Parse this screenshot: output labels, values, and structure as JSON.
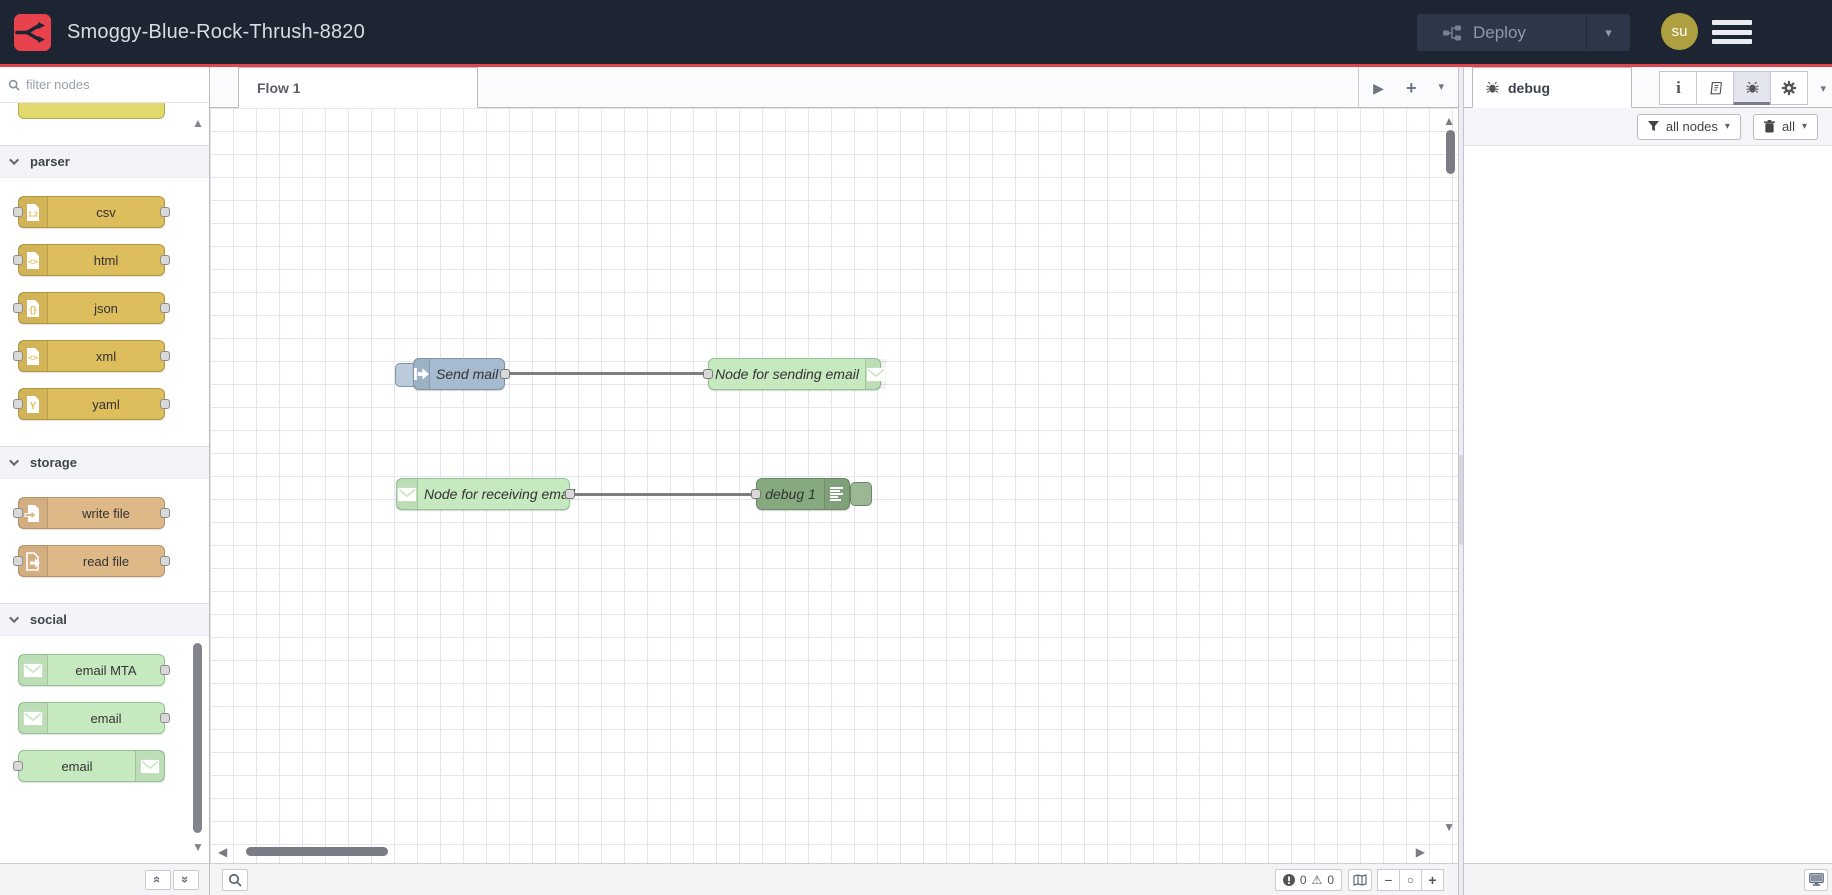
{
  "header": {
    "title": "Smoggy-Blue-Rock-Thrush-8820",
    "deploy_label": "Deploy",
    "user_initials": "su"
  },
  "palette": {
    "search_placeholder": "filter nodes",
    "categories": [
      {
        "label": "parser",
        "nodes": [
          {
            "label": "csv"
          },
          {
            "label": "html"
          },
          {
            "label": "json"
          },
          {
            "label": "xml"
          },
          {
            "label": "yaml"
          }
        ]
      },
      {
        "label": "storage",
        "nodes": [
          {
            "label": "write file"
          },
          {
            "label": "read file"
          }
        ]
      },
      {
        "label": "social",
        "nodes": [
          {
            "label": "email MTA"
          },
          {
            "label": "email"
          },
          {
            "label": "email"
          }
        ]
      }
    ]
  },
  "workspace": {
    "tab_label": "Flow 1",
    "nodes": [
      {
        "label": "Send mail"
      },
      {
        "label": "Node for sending email"
      },
      {
        "label": "Node for receiving email"
      },
      {
        "label": "debug 1"
      }
    ],
    "footer": {
      "errors": "0",
      "warnings": "0"
    }
  },
  "sidebar": {
    "tab_label": "debug",
    "filter_label": "all nodes",
    "clear_label": "all"
  },
  "icons": {
    "caret_down": "▾",
    "play": "▶",
    "plus": "+",
    "minus": "−",
    "zoom_reset": "○",
    "arrow_up": "▲",
    "arrow_down": "▼",
    "arrow_left": "◀",
    "arrow_right": "▶",
    "collapse_up": "«",
    "collapse_down": "»",
    "warning": "⚠",
    "info": "i",
    "csv_glyph": "1,2",
    "angle_glyph": "<>",
    "braces_glyph": "{}",
    "yaml_glyph": "Y"
  },
  "colors": {
    "header_bg": "#1d2533",
    "accent_red": "#e0444c",
    "logo_red": "#e8434d",
    "deploy_bg": "#2c3849",
    "deploy_text": "#8e99ab",
    "avatar_bg": "#ae9f41",
    "node_inject": "#a6bbcf",
    "node_parser": "#debd5c",
    "node_storage": "#deb887",
    "node_email": "#c7e9c0",
    "node_debug": "#87a980",
    "node_sequence": "#e2d96e",
    "grid_line": "#e5e5f0",
    "wire": "#7e7e7e",
    "port_fill": "#d9d9d9",
    "port_border": "#8c8c8c",
    "category_bg": "#f4f4f8",
    "footer_bg": "#f4f4f7"
  }
}
